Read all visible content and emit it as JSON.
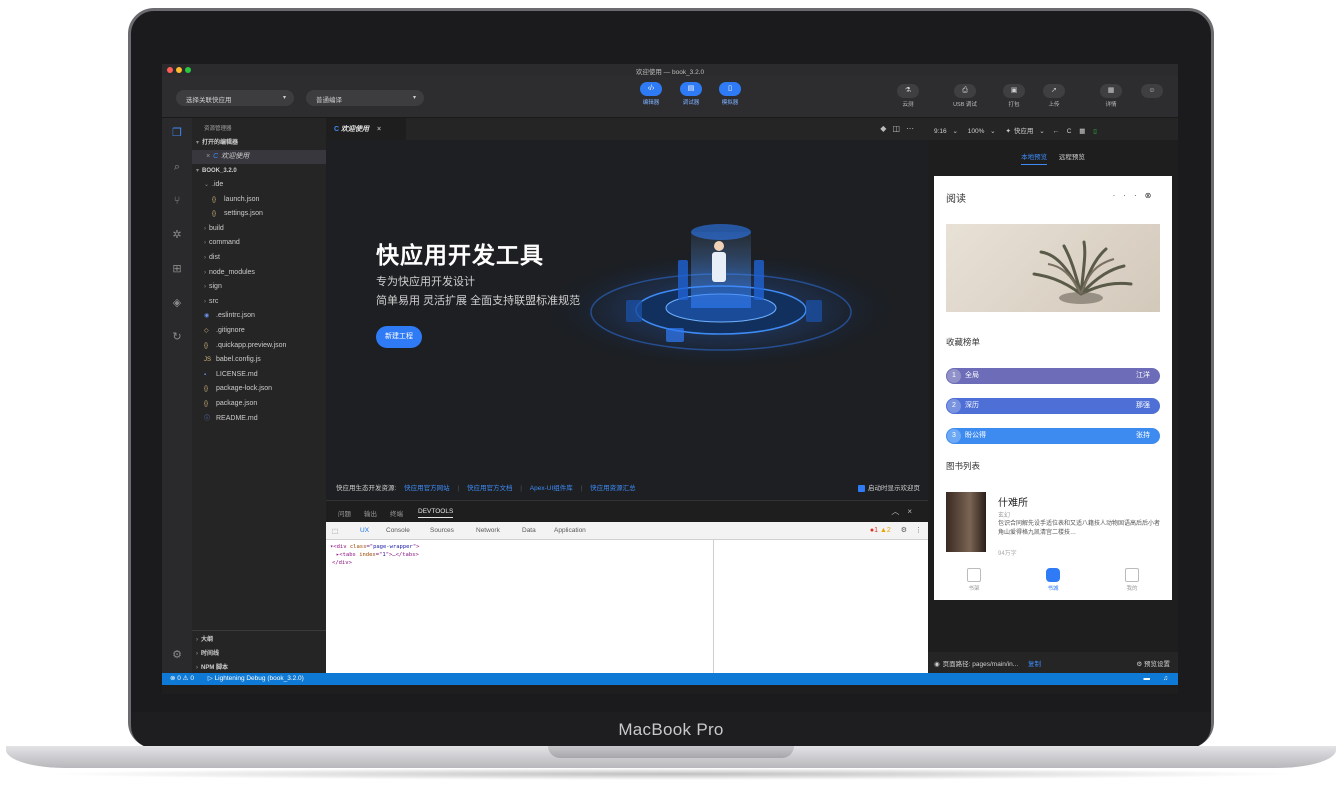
{
  "device": {
    "brand": "MacBook Pro"
  },
  "window": {
    "title": "欢迎使用 — book_3.2.0"
  },
  "toolbar": {
    "project_select": "选择关联快应用",
    "compile_select": "普通编译",
    "modes": [
      {
        "label": "编辑器",
        "icon": "code-icon"
      },
      {
        "label": "调试器",
        "icon": "debugger-icon"
      },
      {
        "label": "模拟器",
        "icon": "simulator-icon"
      }
    ],
    "tools": [
      {
        "label": "云测",
        "icon": "flask-icon"
      },
      {
        "label": "USB 调试",
        "icon": "usb-icon"
      },
      {
        "label": "打包",
        "icon": "package-icon"
      },
      {
        "label": "上传",
        "icon": "upload-icon"
      },
      {
        "label": "详情",
        "icon": "details-icon"
      }
    ]
  },
  "sidebar": {
    "header": "资源管理器",
    "open_editors_label": "打开的编辑器",
    "open_file": "欢迎使用",
    "project_root": "BOOK_3.2.0",
    "tree": [
      {
        "name": ".ide",
        "kind": "folder",
        "open": true,
        "indent": 1
      },
      {
        "name": "launch.json",
        "kind": "json",
        "indent": 2
      },
      {
        "name": "settings.json",
        "kind": "json",
        "indent": 2
      },
      {
        "name": "build",
        "kind": "folder",
        "indent": 1
      },
      {
        "name": "command",
        "kind": "folder",
        "indent": 1
      },
      {
        "name": "dist",
        "kind": "folder",
        "indent": 1
      },
      {
        "name": "node_modules",
        "kind": "folder",
        "indent": 1
      },
      {
        "name": "sign",
        "kind": "folder",
        "indent": 1
      },
      {
        "name": "src",
        "kind": "folder",
        "indent": 1
      },
      {
        "name": ".eslintrc.json",
        "kind": "eslint",
        "indent": 1
      },
      {
        "name": ".gitignore",
        "kind": "git",
        "indent": 1
      },
      {
        "name": ".quickapp.preview.json",
        "kind": "json",
        "indent": 1
      },
      {
        "name": "babel.config.js",
        "kind": "js",
        "indent": 1
      },
      {
        "name": "LICENSE.md",
        "kind": "md",
        "indent": 1
      },
      {
        "name": "package-lock.json",
        "kind": "json",
        "indent": 1
      },
      {
        "name": "package.json",
        "kind": "json",
        "indent": 1
      },
      {
        "name": "README.md",
        "kind": "info",
        "indent": 1
      }
    ],
    "footer": [
      "大纲",
      "时间线",
      "NPM 脚本"
    ]
  },
  "editor": {
    "tab_label": "欢迎使用",
    "hero_title": "快应用开发工具",
    "hero_sub1": "专为快应用开发设计",
    "hero_sub2": "简单易用 灵活扩展 全面支持联盟标准规范",
    "new_project": "新建工程",
    "eco_label": "快应用生态开发资源:",
    "eco_links": [
      "快应用官方网站",
      "快应用官方文档",
      "Apex-UI组件库",
      "快应用资源汇总"
    ],
    "show_on_start": "启动时显示欢迎页"
  },
  "panel": {
    "tabs": [
      "问题",
      "输出",
      "终端",
      "DEVTOOLS"
    ],
    "devtools_tabs": [
      "UX",
      "Console",
      "Sources",
      "Network",
      "Data",
      "Application"
    ],
    "errors": "1",
    "warnings": "2",
    "code": [
      {
        "tag": "div",
        "attr": "class",
        "value": "page-wrapper"
      },
      {
        "tag": "tabs",
        "attr": "index",
        "value": "1"
      },
      {
        "tag": "/div"
      }
    ]
  },
  "simulator": {
    "device_label": "9:16",
    "zoom": "100%",
    "app_label": "快应用",
    "local_preview": "本地预览",
    "remote_preview": "远程预览",
    "phone": {
      "page_title": "阅读",
      "favorites_heading": "收藏榜单",
      "ranks": [
        {
          "num": "1",
          "title": "全局",
          "author": "江洋",
          "color": "#6c6cb8"
        },
        {
          "num": "2",
          "title": "深历",
          "author": "那强",
          "color": "#4d6fd6"
        },
        {
          "num": "3",
          "title": "盼公得",
          "author": "张持",
          "color": "#3d8bf0"
        }
      ],
      "book_list_heading": "图书列表",
      "book": {
        "title": "什难所",
        "category": "玄幻",
        "desc": "包识合同解先设手适位表和又适八籍技人动物固语高后后小者角山爱得格九凯清宫二楼技…",
        "words": "94万字"
      },
      "nav": [
        {
          "label": "书架",
          "active": false
        },
        {
          "label": "书城",
          "active": true
        },
        {
          "label": "我的",
          "active": false
        }
      ]
    },
    "page_path": "页面路径: pages/main/in...",
    "copy": "复制",
    "preview_settings": "预览设置"
  },
  "statusbar": {
    "problems": "0 ⚠ 0",
    "debug": "Lightening Debug (book_3.2.0)"
  }
}
